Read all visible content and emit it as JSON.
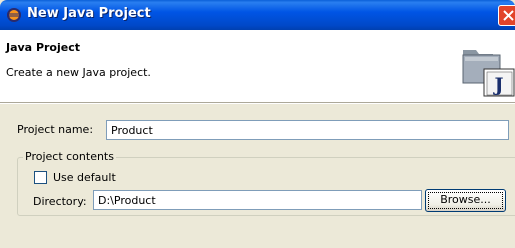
{
  "window": {
    "title": "New Java Project"
  },
  "header": {
    "title": "Java Project",
    "description": "Create a new Java project."
  },
  "form": {
    "project_name": {
      "label": "Project name:",
      "value": "Product"
    },
    "project_contents": {
      "legend": "Project contents",
      "use_default": {
        "label": "Use default",
        "checked": false
      },
      "directory": {
        "label": "Directory:",
        "value": "D:\\Product"
      },
      "browse_label": "Browse..."
    }
  },
  "colors": {
    "titlebar": "#0055e5",
    "dialog_bg": "#ece9d8",
    "close_button": "#e2442a"
  },
  "icons": {
    "app": "eclipse-icon",
    "wizard": "java-project-folder-icon",
    "close": "close-icon"
  }
}
